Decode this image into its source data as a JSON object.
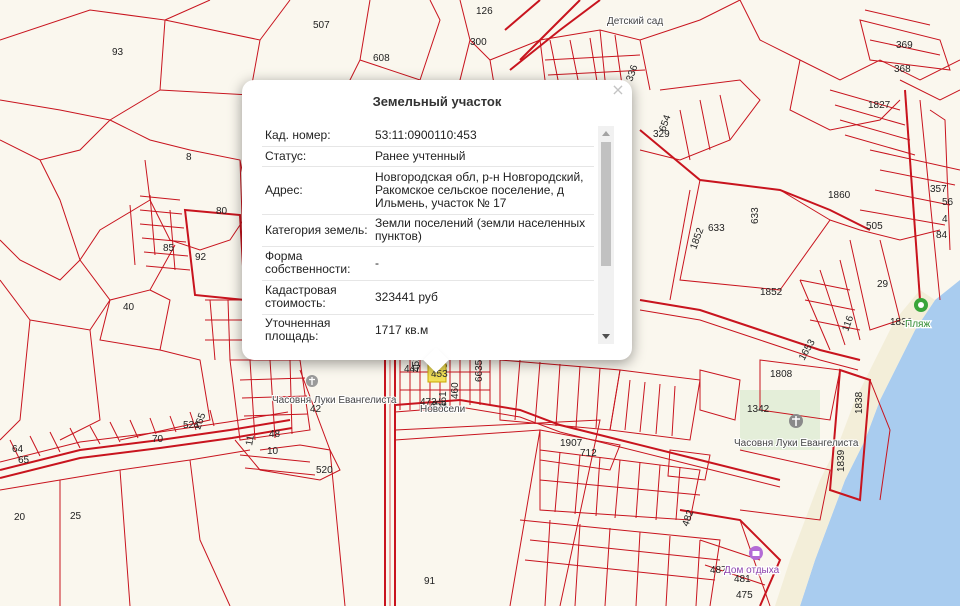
{
  "popup": {
    "title": "Земельный участок",
    "close_glyph": "×",
    "rows": [
      {
        "label": "Кад. номер:",
        "value": "53:11:0900110:453"
      },
      {
        "label": "Статус:",
        "value": "Ранее учтенный"
      },
      {
        "label": "Адрес:",
        "value": "Новгородская обл, р-н Новгородский, Ракомское сельское поселение, д Ильмень, участок № 17"
      },
      {
        "label": "Категория земель:",
        "value": "Земли поселений (земли населенных пунктов)"
      },
      {
        "label": "Форма собственности:",
        "value": "-"
      },
      {
        "label": "Кадастровая стоимость:",
        "value": "323441 руб"
      },
      {
        "label": "Уточненная площадь:",
        "value": "1717 кв.м"
      }
    ]
  },
  "map": {
    "line_color": "#c8141e",
    "water_color": "#a9ccef",
    "green_color": "#d9ead0",
    "plot_labels": [
      "93",
      "507",
      "608",
      "8",
      "80",
      "85",
      "92",
      "40",
      "300",
      "126",
      "336",
      "654",
      "329",
      "369",
      "368",
      "1827",
      "633",
      "633",
      "1852",
      "1852",
      "1860",
      "505",
      "357",
      "56",
      "84",
      "4",
      "29",
      "1836",
      "116",
      "1653",
      "1808",
      "1342",
      "1838",
      "1839",
      "447",
      "452",
      "473",
      "459",
      "461",
      "458",
      "460",
      "6635",
      "70",
      "521",
      "265",
      "11",
      "48",
      "10",
      "520",
      "64",
      "65",
      "20",
      "25",
      "91",
      "1907",
      "712",
      "482",
      "487",
      "481",
      "475",
      "42"
    ],
    "place_labels": [
      "Часовня Луки Евангелиста",
      "Часовня Луки Евангелиста",
      "Новосели",
      "Детский сад"
    ],
    "poi_labels": [
      "Пляж",
      "Дом отдыха"
    ],
    "poi_icons": [
      "beach-icon",
      "church-icon",
      "rest-house-icon",
      "selected-plot-marker-icon"
    ]
  }
}
